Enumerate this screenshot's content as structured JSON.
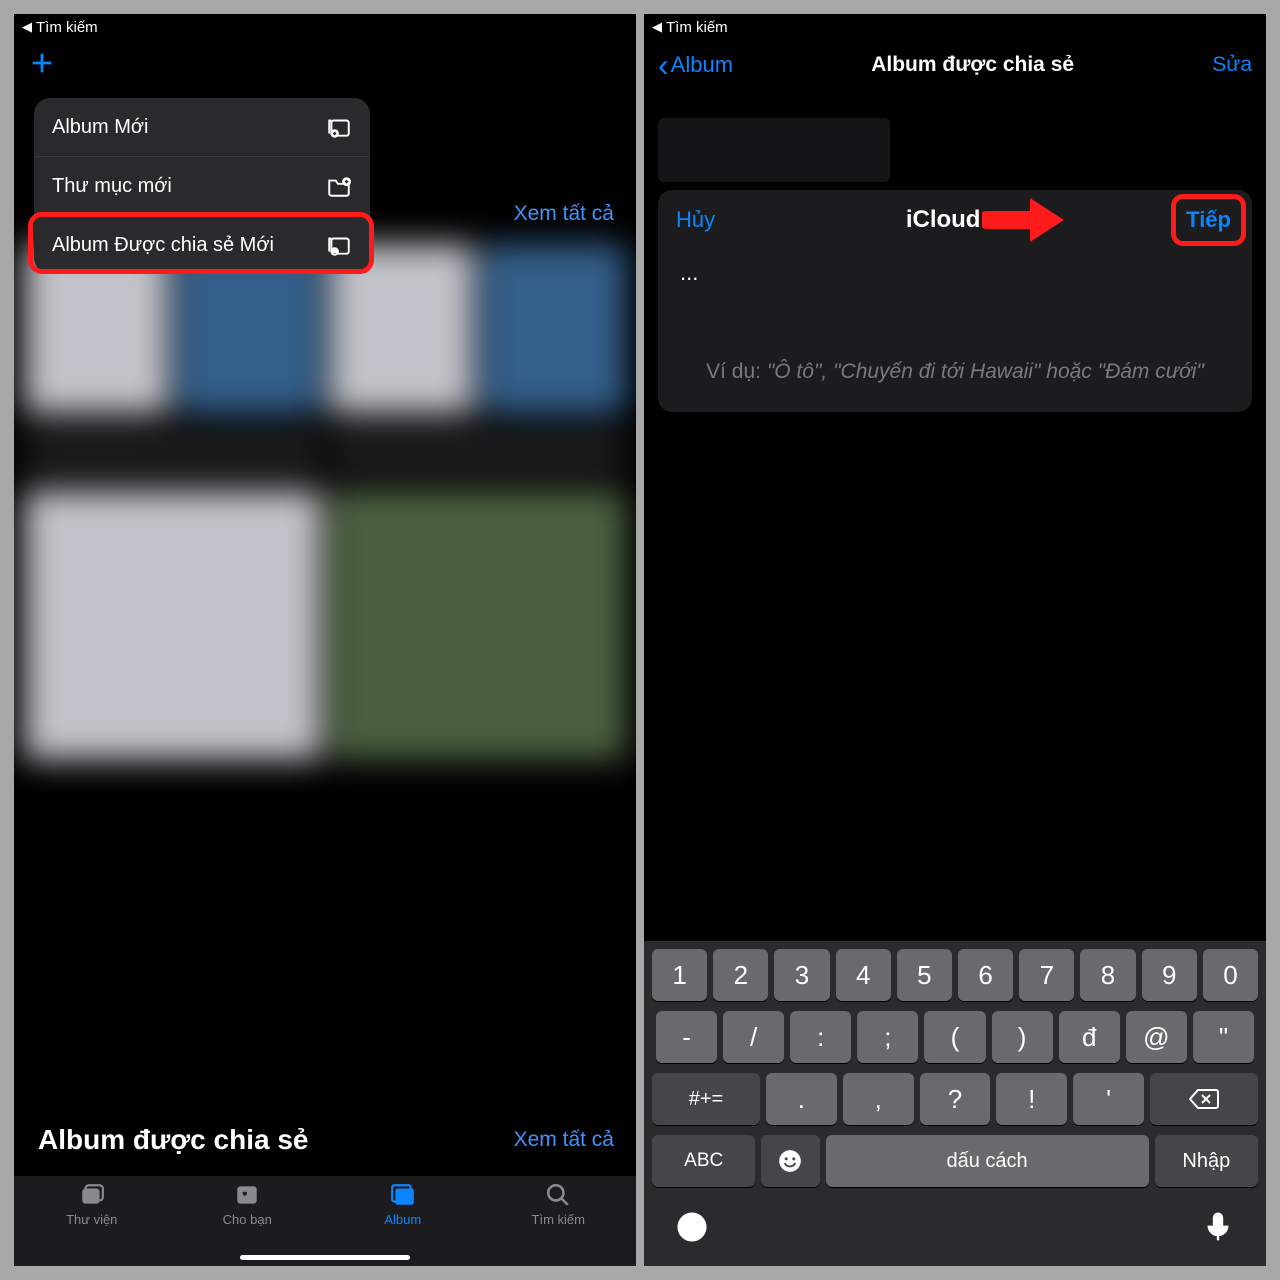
{
  "status": {
    "back_search": "Tìm kiếm"
  },
  "left": {
    "see_all": "Xem tất cả",
    "menu": {
      "new_album": "Album Mới",
      "new_folder": "Thư mục mới",
      "new_shared_album": "Album Được chia sẻ Mới"
    },
    "shared_section": {
      "title": "Album được chia sẻ",
      "see_all": "Xem tất cả"
    },
    "tabs": {
      "library": "Thư viện",
      "for_you": "Cho bạn",
      "album": "Album",
      "search": "Tìm kiếm"
    }
  },
  "right": {
    "nav": {
      "back": "Album",
      "title": "Album được chia sẻ",
      "edit": "Sửa"
    },
    "modal": {
      "cancel": "Hủy",
      "title": "iCloud",
      "next": "Tiếp",
      "input": "...",
      "example_prefix": "Ví dụ: ",
      "example_body": "\"Ô tô\", \"Chuyến đi tới Hawaii\" hoặc \"Đám cưới\""
    },
    "keyboard": {
      "row1": [
        "1",
        "2",
        "3",
        "4",
        "5",
        "6",
        "7",
        "8",
        "9",
        "0"
      ],
      "row2": [
        "-",
        "/",
        ":",
        ";",
        "(",
        ")",
        "đ",
        "@",
        "\""
      ],
      "row3_sym": "#+=",
      "row3": [
        ".",
        ",",
        "?",
        "!",
        "'"
      ],
      "row4_abc": "ABC",
      "row4_space": "dấu cách",
      "row4_enter": "Nhập"
    }
  }
}
